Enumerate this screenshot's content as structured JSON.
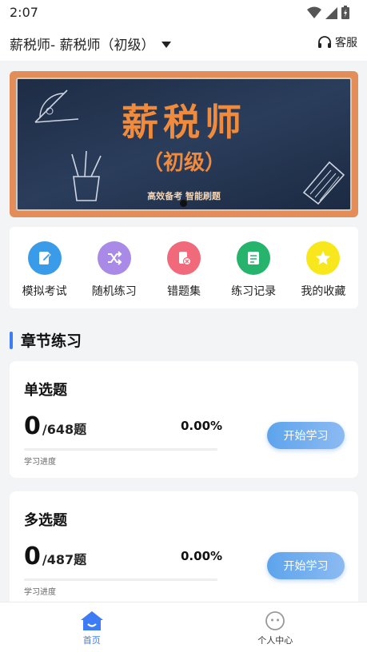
{
  "status": {
    "time": "2:07"
  },
  "header": {
    "title": "薪税师- 薪税师（初级）",
    "service_label": "客服"
  },
  "banner": {
    "title": "薪税师",
    "subtitle": "（初级）",
    "tagline": "高效备考 智能刷题"
  },
  "shortcuts": [
    {
      "label": "模拟考试",
      "icon": "exam-icon",
      "color": "#3a9be8"
    },
    {
      "label": "随机练习",
      "icon": "shuffle-icon",
      "color": "#a98ae6"
    },
    {
      "label": "错题集",
      "icon": "wrong-book-icon",
      "color": "#f16a7b"
    },
    {
      "label": "练习记录",
      "icon": "record-icon",
      "color": "#26b36b"
    },
    {
      "label": "我的收藏",
      "icon": "star-icon",
      "color": "#f8e71c"
    }
  ],
  "section": {
    "title": "章节练习"
  },
  "cards": [
    {
      "title": "单选题",
      "done": "0",
      "total": "/648题",
      "percent": "0.00%",
      "progress": 0,
      "progress_label": "学习进度",
      "button": "开始学习"
    },
    {
      "title": "多选题",
      "done": "0",
      "total": "/487题",
      "percent": "0.00%",
      "progress": 0,
      "progress_label": "学习进度",
      "button": "开始学习"
    }
  ],
  "tabs": [
    {
      "label": "首页",
      "icon": "home-icon",
      "active": true
    },
    {
      "label": "个人中心",
      "icon": "profile-icon",
      "active": false
    }
  ],
  "colors": {
    "accent": "#3d7cf5",
    "banner_orange": "#f08a3c"
  }
}
